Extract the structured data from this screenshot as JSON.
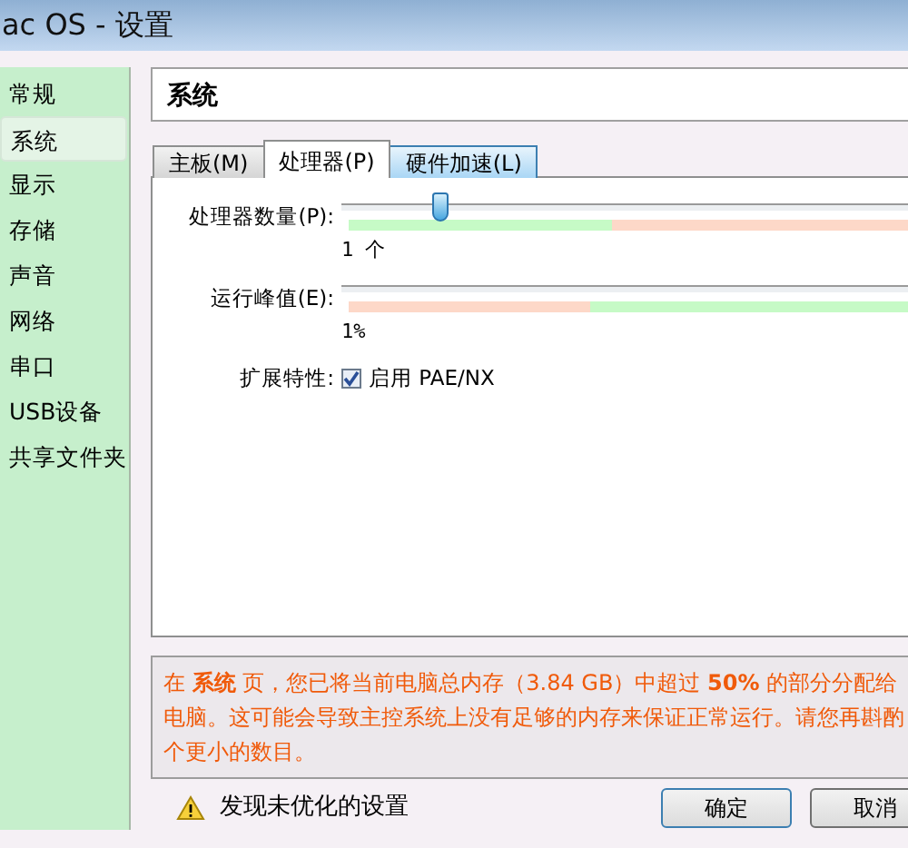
{
  "window": {
    "title": "ac OS - 设置"
  },
  "sidebar": {
    "items": [
      {
        "label": "常规",
        "selected": false
      },
      {
        "label": "系统",
        "selected": true
      },
      {
        "label": "显示",
        "selected": false
      },
      {
        "label": "存储",
        "selected": false
      },
      {
        "label": "声音",
        "selected": false
      },
      {
        "label": "网络",
        "selected": false
      },
      {
        "label": "串口",
        "selected": false
      },
      {
        "label": "USB设备",
        "selected": false
      },
      {
        "label": "共享文件夹",
        "selected": false
      }
    ]
  },
  "header": "系统",
  "tabs": [
    {
      "label": "主板(M)",
      "selected": false
    },
    {
      "label": "处理器(P)",
      "selected": true
    },
    {
      "label": "硬件加速(L)",
      "selected": false
    }
  ],
  "processor_count": {
    "label": "处理器数量(P):",
    "level": 0.1,
    "reading": "1 个"
  },
  "execution_cap": {
    "label": "运行峰值(E):",
    "reading": "1%"
  },
  "extended_features": {
    "label": "扩展特性:",
    "option": "启用 PAE/NX",
    "checked": true
  },
  "warning": {
    "lines": [
      "在 **系统** 页，您已将当前电脑总内存（3.84 GB）中超过 **50%** 的部分分配给",
      "电脑。这可能会导致主控系统上没有足够的内存来保证正常运行。请您再斟酌",
      "个更小的数目。"
    ]
  },
  "status": "发现未优化的设置",
  "buttons": [
    "确定",
    "取消"
  ]
}
